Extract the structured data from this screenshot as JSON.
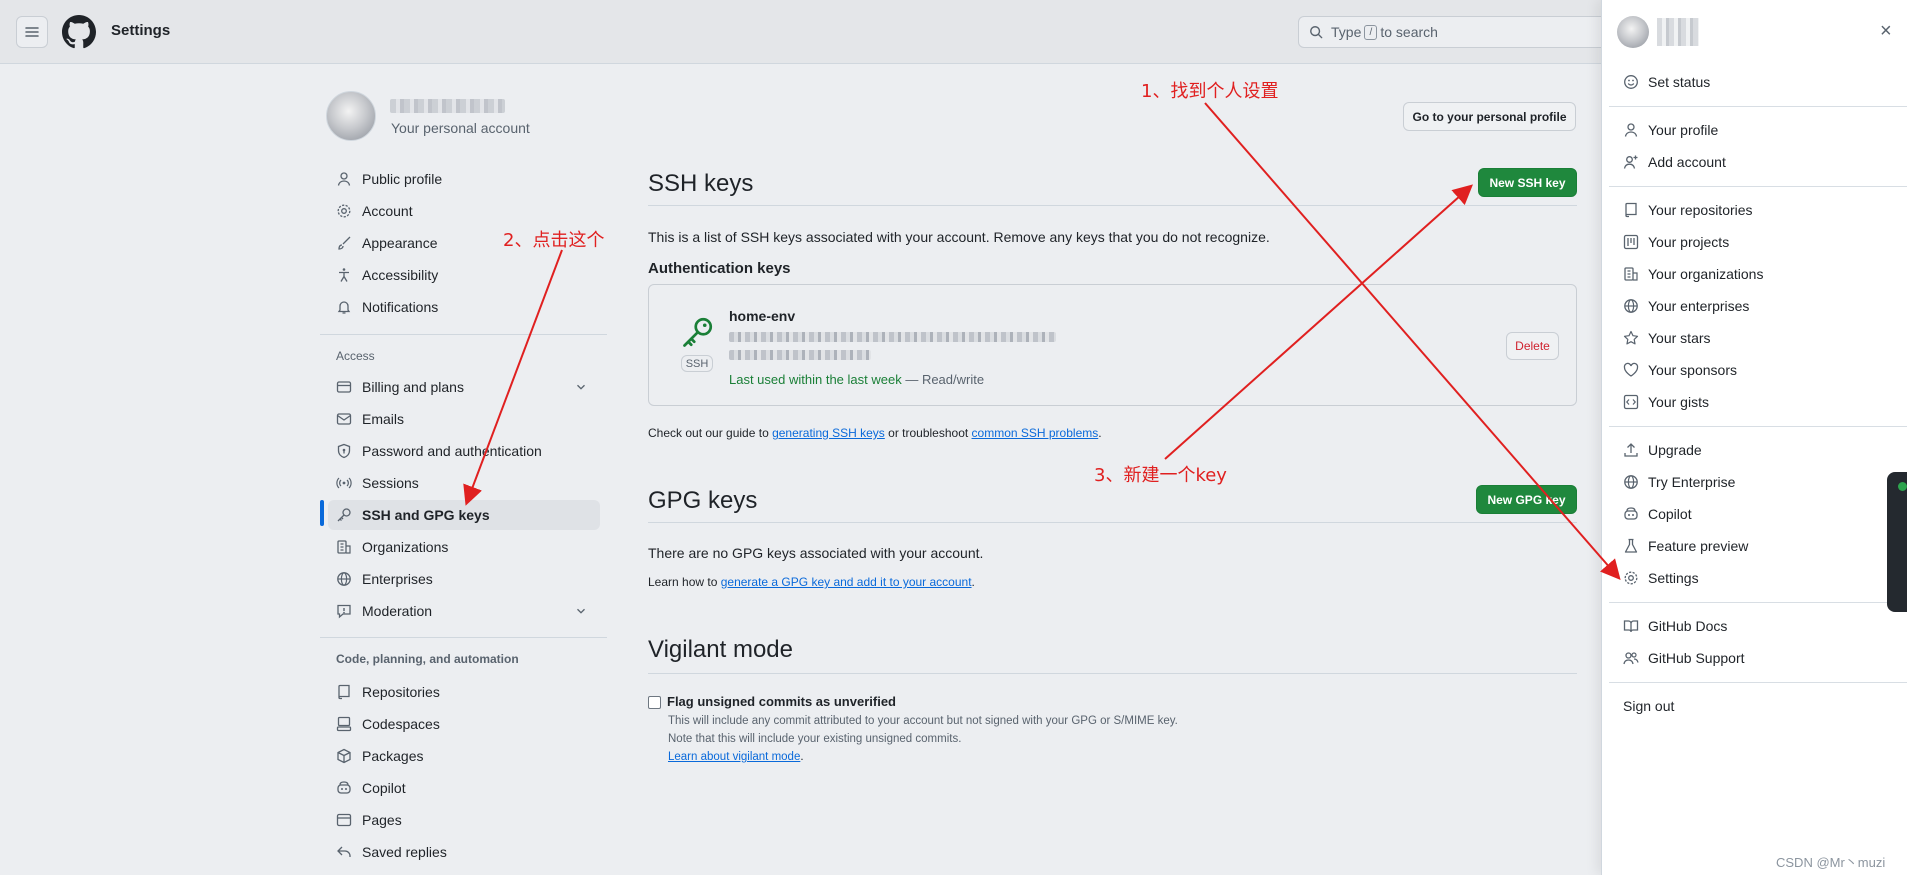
{
  "header": {
    "title": "Settings",
    "search_prefix": "Type",
    "search_key": "/",
    "search_suffix": "to search"
  },
  "account": {
    "subtitle": "Your personal account",
    "profile_button": "Go to your personal profile"
  },
  "sidebar": {
    "items_top": [
      {
        "label": "Public profile",
        "icon": "person-icon"
      },
      {
        "label": "Account",
        "icon": "gear-icon"
      },
      {
        "label": "Appearance",
        "icon": "paintbrush-icon"
      },
      {
        "label": "Accessibility",
        "icon": "accessibility-icon"
      },
      {
        "label": "Notifications",
        "icon": "bell-icon"
      }
    ],
    "access_heading": "Access",
    "items_access": [
      {
        "label": "Billing and plans",
        "icon": "credit-card-icon"
      },
      {
        "label": "Emails",
        "icon": "mail-icon"
      },
      {
        "label": "Password and authentication",
        "icon": "shield-lock-icon"
      },
      {
        "label": "Sessions",
        "icon": "broadcast-icon"
      },
      {
        "label": "SSH and GPG keys",
        "icon": "key-icon"
      },
      {
        "label": "Organizations",
        "icon": "organization-icon"
      },
      {
        "label": "Enterprises",
        "icon": "globe-icon"
      },
      {
        "label": "Moderation",
        "icon": "report-icon"
      }
    ],
    "code_heading": "Code, planning, and automation",
    "items_code": [
      {
        "label": "Repositories",
        "icon": "repo-icon"
      },
      {
        "label": "Codespaces",
        "icon": "codespaces-icon"
      },
      {
        "label": "Packages",
        "icon": "package-icon"
      },
      {
        "label": "Copilot",
        "icon": "copilot-icon"
      },
      {
        "label": "Pages",
        "icon": "browser-icon"
      },
      {
        "label": "Saved replies",
        "icon": "reply-icon"
      }
    ]
  },
  "ssh": {
    "title": "SSH keys",
    "new_button": "New SSH key",
    "description": "This is a list of SSH keys associated with your account. Remove any keys that you do not recognize.",
    "auth_heading": "Authentication keys",
    "key": {
      "name": "home-env",
      "badge": "SSH",
      "last_used": "Last used within the last week",
      "access": " — Read/write",
      "delete_label": "Delete"
    },
    "guide_prefix": "Check out our guide to ",
    "guide_link1": "generating SSH keys",
    "guide_middle": " or troubleshoot ",
    "guide_link2": "common SSH problems",
    "guide_suffix": "."
  },
  "gpg": {
    "title": "GPG keys",
    "new_button": "New GPG key",
    "none_text": "There are no GPG keys associated with your account.",
    "learn_prefix": "Learn how to ",
    "learn_link": "generate a GPG key and add it to your account",
    "learn_suffix": "."
  },
  "vigilant": {
    "title": "Vigilant mode",
    "checkbox_label": "Flag unsigned commits as unverified",
    "line1": "This will include any commit attributed to your account but not signed with your GPG or S/MIME key.",
    "line2": "Note that this will include your existing unsigned commits.",
    "link": "Learn about vigilant mode",
    "link_suffix": "."
  },
  "drawer": {
    "set_status": "Set status",
    "group1": [
      {
        "label": "Your profile",
        "icon": "person-icon"
      },
      {
        "label": "Add account",
        "icon": "person-add-icon"
      }
    ],
    "group2": [
      {
        "label": "Your repositories",
        "icon": "repo-icon"
      },
      {
        "label": "Your projects",
        "icon": "project-icon"
      },
      {
        "label": "Your organizations",
        "icon": "organization-icon"
      },
      {
        "label": "Your enterprises",
        "icon": "globe-icon"
      },
      {
        "label": "Your stars",
        "icon": "star-icon"
      },
      {
        "label": "Your sponsors",
        "icon": "heart-icon"
      },
      {
        "label": "Your gists",
        "icon": "code-square-icon"
      }
    ],
    "group3": [
      {
        "label": "Upgrade",
        "icon": "upload-icon"
      },
      {
        "label": "Try Enterprise",
        "icon": "globe-icon"
      },
      {
        "label": "Copilot",
        "icon": "copilot-icon"
      },
      {
        "label": "Feature preview",
        "icon": "beaker-icon"
      },
      {
        "label": "Settings",
        "icon": "gear-icon"
      }
    ],
    "group4": [
      {
        "label": "GitHub Docs",
        "icon": "book-icon"
      },
      {
        "label": "GitHub Support",
        "icon": "people-icon"
      }
    ],
    "sign_out": "Sign out"
  },
  "annotations": {
    "step1": "1、找到个人设置",
    "step2": "2、点击这个",
    "step3": "3、新建一个key"
  },
  "watermark": "CSDN @Mr丶muzi",
  "colors": {
    "accent_green": "#1f883d",
    "link_blue": "#0969da",
    "annotation_red": "#e02020",
    "danger_red": "#cf222e"
  }
}
